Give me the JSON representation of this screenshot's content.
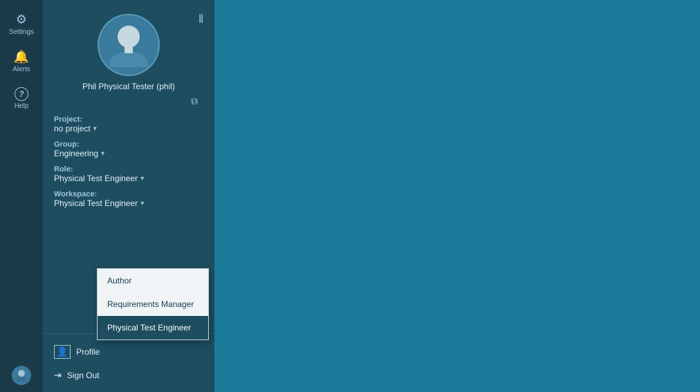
{
  "leftRail": {
    "items": [
      {
        "id": "settings",
        "label": "Settings",
        "icon": "⚙"
      },
      {
        "id": "alerts",
        "label": "Alerts",
        "icon": "🔔"
      },
      {
        "id": "help",
        "label": "Help",
        "icon": "?"
      }
    ],
    "bottomItem": {
      "id": "user",
      "label": "",
      "icon": "👤"
    }
  },
  "sidebar": {
    "expandIcon": "⊞",
    "editIcon": "⧉",
    "profile": {
      "name": "Phil Physical Tester (phil)"
    },
    "fields": [
      {
        "id": "project",
        "label": "Project:",
        "value": "no project",
        "hasDropdown": true
      },
      {
        "id": "group",
        "label": "Group:",
        "value": "Engineering",
        "hasDropdown": true
      },
      {
        "id": "role",
        "label": "Role:",
        "value": "Physical Test Engineer",
        "hasDropdown": true
      },
      {
        "id": "workspace",
        "label": "Workspace:",
        "value": "Physical Test Engineer",
        "hasDropdown": true
      }
    ],
    "dropdown": {
      "items": [
        {
          "id": "author",
          "label": "Author",
          "selected": false
        },
        {
          "id": "requirements-manager",
          "label": "Requirements Manager",
          "selected": false
        },
        {
          "id": "physical-test-engineer",
          "label": "Physical Test Engineer",
          "selected": true
        }
      ]
    },
    "actions": [
      {
        "id": "profile",
        "label": "Profile",
        "icon": "👤"
      },
      {
        "id": "sign-out",
        "label": "Sign Out",
        "icon": "→"
      }
    ]
  }
}
